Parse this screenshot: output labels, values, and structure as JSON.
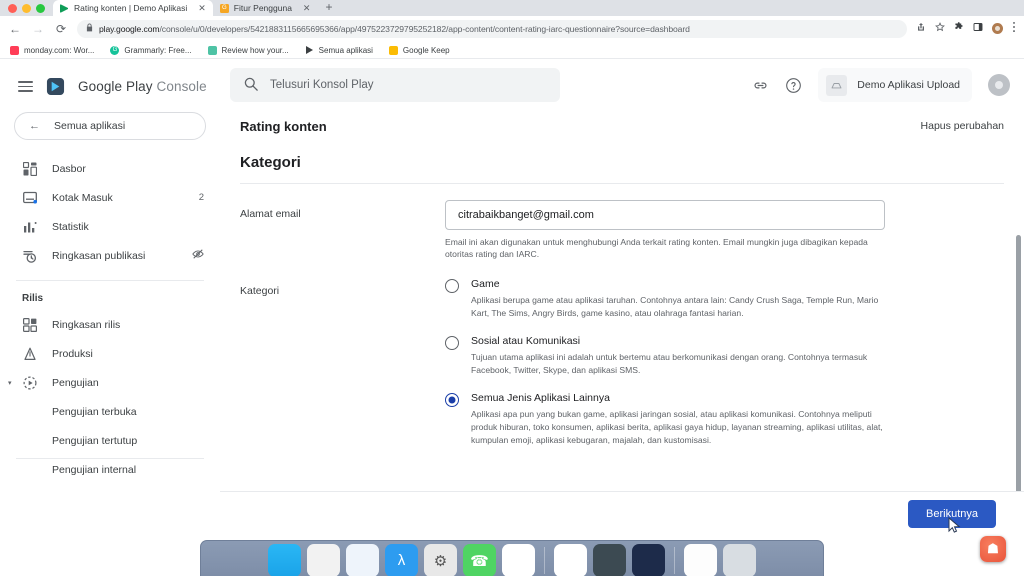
{
  "browser": {
    "tabs": [
      {
        "title": "Rating konten | Demo Aplikasi",
        "favicon": "play-console-icon",
        "active": true,
        "close_label": "✕"
      },
      {
        "title": "Fitur Pengguna",
        "favicon": "orange-app-icon",
        "active": false,
        "close_label": "✕"
      }
    ],
    "new_tab_label": "+",
    "nav": {
      "back": "←",
      "forward": "→",
      "reload": "⟳"
    },
    "omnibox": {
      "lock": "🔒",
      "url_host": "play.google.com",
      "url_path": "/console/u/0/developers/5421883115665695366/app/4975223729795252182/app-content/content-rating-iarc-questionnaire?source=dashboard"
    },
    "toolbar_icons": [
      "share-icon",
      "bookmark-star-icon",
      "extensions-icon",
      "side-panel-icon",
      "profile-avatar-icon",
      "chrome-menu-icon"
    ],
    "bookmarks": [
      {
        "label": "monday.com: Wor...",
        "icon": "monday-icon",
        "color": "#ff3d57"
      },
      {
        "label": "Grammarly: Free...",
        "icon": "grammarly-icon",
        "color": "#15c39a"
      },
      {
        "label": "Review how your...",
        "icon": "cloud-icon",
        "color": "#4ec3a5"
      },
      {
        "label": "Semua aplikasi",
        "icon": "play-console-icon",
        "color": "#0f9d58"
      },
      {
        "label": "Google Keep",
        "icon": "keep-icon",
        "color": "#fbbc04"
      }
    ]
  },
  "sidebar": {
    "menu_icon": "hamburger-icon",
    "brand_name": "Google Play",
    "brand_suffix": "Console",
    "all_apps": {
      "label": "Semua aplikasi",
      "icon": "back-arrow-icon"
    },
    "items": [
      {
        "label": "Dasbor",
        "icon": "dashboard-icon",
        "badge": ""
      },
      {
        "label": "Kotak Masuk",
        "icon": "inbox-icon",
        "badge": "2"
      },
      {
        "label": "Statistik",
        "icon": "statistics-icon",
        "badge": ""
      },
      {
        "label": "Ringkasan publikasi",
        "icon": "publishing-overview-icon",
        "badge": "visibility-off-icon"
      }
    ],
    "section_title": "Rilis",
    "release_items": [
      {
        "label": "Ringkasan rilis",
        "icon": "release-overview-icon",
        "sub": false,
        "expandable": false
      },
      {
        "label": "Produksi",
        "icon": "production-icon",
        "sub": false,
        "expandable": false
      },
      {
        "label": "Pengujian",
        "icon": "testing-icon",
        "sub": false,
        "expandable": true,
        "caret": "▾"
      },
      {
        "label": "Pengujian terbuka",
        "icon": "",
        "sub": true,
        "expandable": false
      },
      {
        "label": "Pengujian tertutup",
        "icon": "",
        "sub": true,
        "expandable": false
      },
      {
        "label": "Pengujian internal",
        "icon": "",
        "sub": true,
        "expandable": false
      }
    ]
  },
  "appbar": {
    "search_placeholder": "Telusuri Konsol Play",
    "search_icon": "search-icon",
    "link_icon": "link-icon",
    "help_icon": "help-icon",
    "app_chip": {
      "label": "Demo Aplikasi Upload",
      "icon": "app-thumbnail-icon"
    },
    "account_avatar": "account-avatar-icon"
  },
  "header": {
    "page_title": "Rating konten",
    "discard_label": "Hapus perubahan"
  },
  "main": {
    "section_title": "Kategori",
    "email": {
      "label": "Alamat email",
      "value": "citrabaikbanget@gmail.com",
      "helper": "Email ini akan digunakan untuk menghubungi Anda terkait rating konten. Email mungkin juga dibagikan kepada otoritas rating dan IARC."
    },
    "category": {
      "label": "Kategori",
      "options": [
        {
          "title": "Game",
          "description": "Aplikasi berupa game atau aplikasi taruhan. Contohnya antara lain: Candy Crush Saga, Temple Run, Mario Kart, The Sims, Angry Birds, game kasino, atau olahraga fantasi harian.",
          "selected": false
        },
        {
          "title": "Sosial atau Komunikasi",
          "description": "Tujuan utama aplikasi ini adalah untuk bertemu atau berkomunikasi dengan orang. Contohnya termasuk Facebook, Twitter, Skype, dan aplikasi SMS.",
          "selected": false
        },
        {
          "title": "Semua Jenis Aplikasi Lainnya",
          "description": "Aplikasi apa pun yang bukan game, aplikasi jaringan sosial, atau aplikasi komunikasi. Contohnya meliputi produk hiburan, toko konsumen, aplikasi berita, aplikasi gaya hidup, layanan streaming, aplikasi utilitas, alat, kumpulan emoji, aplikasi kebugaran, majalah, dan kustomisasi.",
          "selected": true
        }
      ]
    }
  },
  "footer": {
    "next_label": "Berikutnya",
    "cursor": "mouse-pointer-icon"
  },
  "dock": {
    "icons": [
      {
        "name": "finder-icon",
        "glyph": "",
        "color": "#1aa3e8"
      },
      {
        "name": "launchpad-icon",
        "glyph": "",
        "color": "#f2f2f2"
      },
      {
        "name": "safari-icon",
        "glyph": "",
        "color": "#ffffff"
      },
      {
        "name": "xcode-icon",
        "glyph": "λ",
        "color": "#2d9cf0"
      },
      {
        "name": "settings-gear-icon",
        "glyph": "⚙",
        "color": "#e8e8e8"
      },
      {
        "name": "whatsapp-icon",
        "glyph": "✆",
        "color": "#4fd463"
      },
      {
        "name": "slack-icon",
        "glyph": "",
        "color": "#ffffff"
      },
      {
        "name": "chrome-icon",
        "glyph": "",
        "color": "#ffffff"
      },
      {
        "name": "terminal-icon",
        "glyph": "",
        "color": "#3c4a52"
      },
      {
        "name": "zoom-icon",
        "glyph": "",
        "color": "#1d2b4a"
      },
      {
        "name": "notes-icon",
        "glyph": "",
        "color": "#fdfdfd"
      },
      {
        "name": "trash-icon",
        "glyph": "",
        "color": "#d8dde2"
      }
    ]
  },
  "colors": {
    "accent": "#2b59c3",
    "radio_selected": "#1a3ea8",
    "radio_halo": "#e8f0fe",
    "text_primary": "#202124",
    "text_secondary": "#5f6368"
  }
}
